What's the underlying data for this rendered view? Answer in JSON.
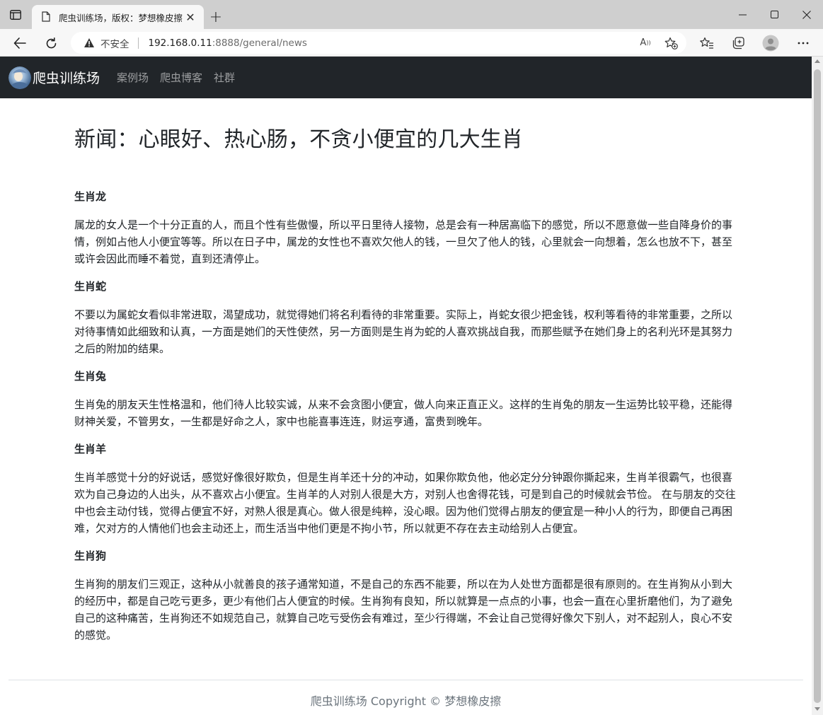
{
  "browser": {
    "tab_title": "爬虫训练场，版权：梦想橡皮擦",
    "address": {
      "security_label": "不安全",
      "host": "192.168.0.11",
      "path": ":8888/general/news"
    }
  },
  "site": {
    "brand": "爬虫训练场",
    "nav_items": [
      "案例场",
      "爬虫博客",
      "社群"
    ]
  },
  "article": {
    "title": "新闻：心眼好、热心肠，不贪小便宜的几大生肖",
    "sections": [
      {
        "heading": "生肖龙",
        "body": "属龙的女人是一个十分正直的人，而且个性有些傲慢，所以平日里待人接物，总是会有一种居高临下的感觉，所以不愿意做一些自降身价的事情，例如占他人小便宜等等。所以在日子中，属龙的女性也不喜欢欠他人的钱，一旦欠了他人的钱，心里就会一向想着，怎么也放不下，甚至或许会因此而睡不着觉，直到还清停止。"
      },
      {
        "heading": "生肖蛇",
        "body": "不要以为属蛇女看似非常进取，渴望成功，就觉得她们将名利看待的非常重要。实际上，肖蛇女很少把金钱，权利等看待的非常重要，之所以对待事情如此细致和认真，一方面是她们的天性使然，另一方面则是生肖为蛇的人喜欢挑战自我，而那些赋予在她们身上的名利光环是其努力之后的附加的结果。"
      },
      {
        "heading": "生肖兔",
        "body": "生肖兔的朋友天生性格温和，他们待人比较实诚，从来不会贪图小便宜，做人向来正直正义。这样的生肖兔的朋友一生运势比较平稳，还能得财神关爱，不管男女，一生都是好命之人，家中也能喜事连连，财运亨通，富贵到晚年。"
      },
      {
        "heading": "生肖羊",
        "body": "生肖羊感觉十分的好说话，感觉好像很好欺负，但是生肖羊还十分的冲动，如果你欺负他，他必定分分钟跟你撕起来，生肖羊很霸气，也很喜欢为自己身边的人出头，从不喜欢占小便宜。生肖羊的人对别人很是大方，对别人也舍得花钱，可是到自己的时候就会节俭。 在与朋友的交往中也会主动付钱，觉得占便宜不好，对熟人很是真心。做人很是纯粹，没心眼。因为他们觉得占朋友的便宜是一种小人的行为，即便自己再困难，欠对方的人情他们也会主动还上，而生活当中他们更是不拘小节，所以就更不存在去主动给别人占便宜。"
      },
      {
        "heading": "生肖狗",
        "body": "生肖狗的朋友们三观正，这种从小就善良的孩子通常知道，不是自己的东西不能要，所以在为人处世方面都是很有原则的。在生肖狗从小到大的经历中，都是自己吃亏更多，更少有他们占人便宜的时候。生肖狗有良知，所以就算是一点点的小事，也会一直在心里折磨他们，为了避免自己的这种痛苦，生肖狗还不如规范自己，就算自己吃亏受伤会有难过，至少行得端，不会让自己觉得好像欠下别人，对不起别人，良心不安的感觉。"
      }
    ]
  },
  "footer": {
    "text": "爬虫训练场 Copyright © 梦想橡皮擦"
  },
  "icons": {
    "tab_actions": "tab-actions-icon",
    "favicon": "document-icon",
    "close": "close-icon",
    "new_tab": "plus-icon",
    "back": "back-arrow-icon",
    "refresh": "refresh-icon",
    "warning": "warning-icon",
    "read_aloud": "read-aloud-icon",
    "add_favorite": "star-plus-icon",
    "favorites": "favorites-icon",
    "collections": "collections-icon",
    "profile": "profile-icon",
    "more": "more-icon"
  },
  "colors": {
    "navbar_bg": "#212529",
    "nav_link": "#9a9da0",
    "footer_text": "#6c757d"
  }
}
